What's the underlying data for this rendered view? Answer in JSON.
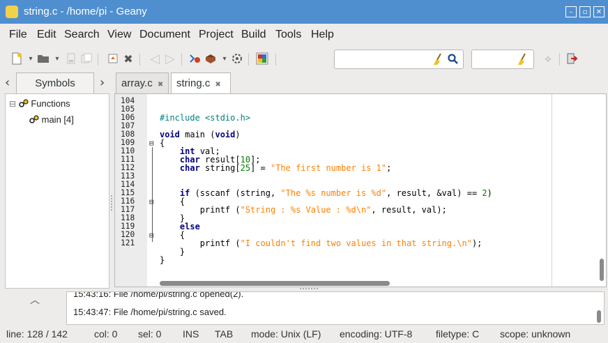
{
  "window": {
    "title": "string.c - /home/pi - Geany",
    "btn_min": "–",
    "btn_max": "▫",
    "btn_close": "✕"
  },
  "menu": [
    "File",
    "Edit",
    "Search",
    "View",
    "Document",
    "Project",
    "Build",
    "Tools",
    "Help"
  ],
  "sidebar": {
    "tab_label": "Symbols",
    "arrow_left": "‹",
    "arrow_right": "›",
    "tree": {
      "group": "Functions",
      "expander": "⊟",
      "item": "main [4]"
    }
  },
  "tabs": [
    {
      "label": "array.c",
      "close": "✖"
    },
    {
      "label": "string.c",
      "close": "✖"
    }
  ],
  "editor": {
    "line_numbers": [
      "104",
      "105",
      "106",
      "107",
      "108",
      "109",
      "110",
      "111",
      "112",
      "113",
      "114",
      "115",
      "116",
      "117",
      "118",
      "119",
      "120",
      "121"
    ]
  },
  "messages": [
    "15:43:16: File /home/pi/string.c opened(2).",
    "15:43:47: File /home/pi/string.c saved."
  ],
  "status": {
    "line": "line: 128 / 142",
    "col": "col: 0",
    "sel": "sel: 0",
    "ins": "INS",
    "tab": "TAB",
    "mode": "mode: Unix (LF)",
    "encoding": "encoding: UTF-8",
    "filetype": "filetype: C",
    "scope": "scope: unknown"
  },
  "colors": {
    "titlebar": "#4f8fcf",
    "keyword": "#00007f",
    "string": "#ff8000",
    "preprocessor": "#007f7f",
    "number": "#007f00"
  }
}
